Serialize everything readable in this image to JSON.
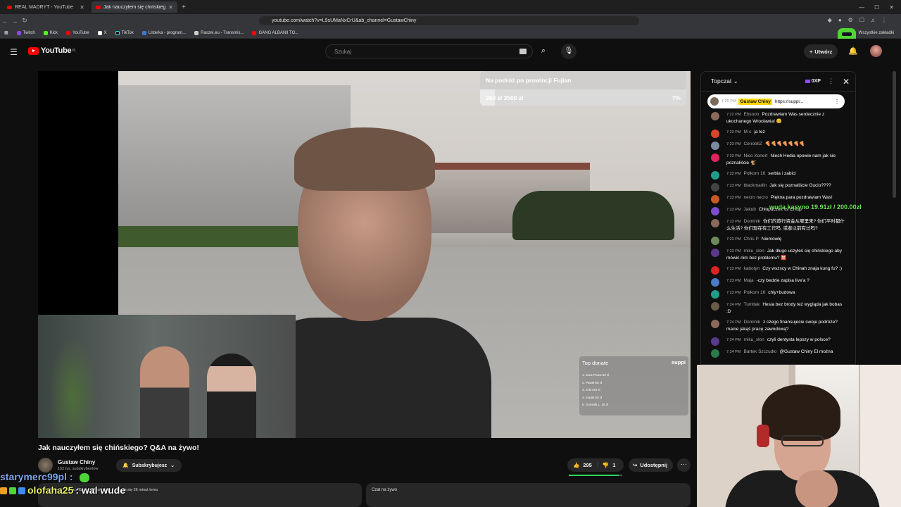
{
  "browser": {
    "tabs": [
      {
        "title": "REAL MADRYT - YouTube",
        "active": false
      },
      {
        "title": "Jak nauczyłem się chińskiego? Q&A na żywo!",
        "active": true
      }
    ],
    "url": "youtube.com/watch?v=L9sUMaNxCrU&ab_channel=GustawChiny",
    "bookmarks": [
      "Twitch",
      "Kick",
      "YouTube",
      "X",
      "TikTok",
      "Usterka - program...",
      "Raszei.eu - Transmis...",
      "GANG ALBANII TO..."
    ],
    "bookmarks_all": "Wszystkie zakładki"
  },
  "youtube": {
    "logo": "YouTube",
    "logo_region": "PL",
    "search_placeholder": "Szukaj",
    "create_label": "Utwórz"
  },
  "video": {
    "goal_title": "Na podróż po prowincji Fujian",
    "goal_range": "260 zł 3500 zł",
    "goal_percent_label": "7%",
    "goal_fraction": 0.07,
    "top_donate_title": "Top donate",
    "top_donate_brand": "suppi",
    "top_donate_list": [
      "1. Jaca Praca 50 zł",
      "2. Paweł 50 zł",
      "3. John 50 zł",
      "4. madel 50 zł",
      "5. Dominik L. 26 zł"
    ],
    "title": "Jak nauczyłem się chińskiego? Q&A na żywo!",
    "channel": "Gustaw Chiny",
    "subscribers": "152 tys. subskrybentów",
    "subscribed_label": "Subskrybujesz",
    "likes": "295",
    "dislikes": "1",
    "share_label": "Udostępnij",
    "description_preview": "W tej chwili ogląda 985 osób. Transmisja zaczęła się 26 minut temu",
    "livechat_label": "Czat na żywo"
  },
  "chat": {
    "title": "Topczat",
    "xp": "0XP",
    "pinned": {
      "time": "7:20 PM",
      "name": "Gustaw Chiny",
      "text": "https://suppi..."
    },
    "messages": [
      {
        "time": "7:22 PM",
        "name": "Ebsoon",
        "text": "Pozdrawiam Was serdecznie z ukochanego Wrocławia! 😊",
        "color": "#8a6a5a"
      },
      {
        "time": "7:23 PM",
        "name": "M-c",
        "text": "ja też",
        "color": "#d9452b"
      },
      {
        "time": "7:23 PM",
        "name": "CenoblIZ",
        "text": "🍕🍕🍕🍕🍕🍕🍕",
        "color": "#7a8aa0"
      },
      {
        "time": "7:23 PM",
        "name": "Nico Xonert",
        "text": "Niech Hedia opowie nam jak sie poznaliście 🐒",
        "color": "#e0245e"
      },
      {
        "time": "7:23 PM",
        "name": "Polkom 16",
        "text": "serbia i zabici",
        "color": "#1f9e8c"
      },
      {
        "time": "7:23 PM",
        "name": "blackmarlin",
        "text": "Jak się poznaliście Gucio????",
        "color": "#444"
      },
      {
        "time": "7:23 PM",
        "name": "necro necro",
        "text": "Piękna para pozdrawiam Was!",
        "color": "#c75a25"
      },
      {
        "time": "7:23 PM",
        "name": "Jakub",
        "text": "Chłopaczek vs Chłop",
        "color": "#7c4dcf"
      },
      {
        "time": "7:23 PM",
        "name": "Dominik",
        "text": "你们的旅行资金从哪里来? 你们平时都什么生活? 你们现在有工作吗, 或者以前有过吗?",
        "color": "#8a6a5a"
      },
      {
        "time": "7:23 PM",
        "name": "Chris P",
        "text": "Niemowlę",
        "color": "#6a8a5a"
      },
      {
        "time": "7:23 PM",
        "name": "miku_slon",
        "text": "Jak długo uczyłeś się chińskiego aby mówić nim bez problemu? 🈲",
        "color": "#5a3a8a"
      },
      {
        "time": "7:23 PM",
        "name": "kabotyn",
        "text": "Czy wszscy w Chinah znaja kung fu? :)",
        "color": "#d22"
      },
      {
        "time": "7:23 PM",
        "name": "Maja",
        "text": "-czy bedzie zapisa live'a ?",
        "color": "#4a7ac8"
      },
      {
        "time": "7:23 PM",
        "name": "Polkom 16",
        "text": "chiy+budowa",
        "color": "#1f9e8c"
      },
      {
        "time": "7:24 PM",
        "name": "Tumltak",
        "text": "Hesia bez brody też wygląda jak bobas :D",
        "color": "#6a5a4a"
      },
      {
        "time": "7:24 PM",
        "name": "Dominik",
        "text": "z czego finansujecie swoje podróże? macie jakąś pracę zawodową?",
        "color": "#8a6a5a"
      },
      {
        "time": "7:24 PM",
        "name": "miku_slon",
        "text": "czyli dentysta lepszy w polsce?",
        "color": "#5a3a8a"
      },
      {
        "time": "7:24 PM",
        "name": "Bartek Szczudło",
        "text": "@Gustaw Chiny El można",
        "color": "#2a7a4a"
      }
    ]
  },
  "stream_overlay": {
    "kasyno": "wuda kasyno 19.91zł / 200.00zł",
    "chat_lines": [
      {
        "name": "starymerc99pl",
        "text": ":"
      },
      {
        "name": "olofaha25",
        "text": ": wal wude"
      }
    ]
  }
}
